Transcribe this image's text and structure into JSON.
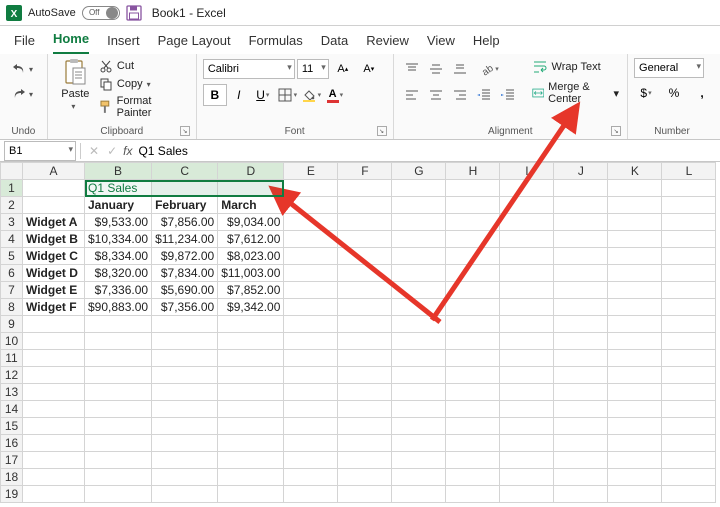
{
  "titlebar": {
    "autosave_label": "AutoSave",
    "autosave_state": "Off",
    "doc_title": "Book1 - Excel"
  },
  "tabs": {
    "file": "File",
    "home": "Home",
    "insert": "Insert",
    "page_layout": "Page Layout",
    "formulas": "Formulas",
    "data": "Data",
    "review": "Review",
    "view": "View",
    "help": "Help"
  },
  "ribbon": {
    "undo_label": "Undo",
    "clipboard": {
      "paste": "Paste",
      "cut": "Cut",
      "copy": "Copy",
      "format_painter": "Format Painter",
      "group": "Clipboard"
    },
    "font": {
      "name": "Calibri",
      "size": "11",
      "group": "Font"
    },
    "alignment": {
      "wrap_text": "Wrap Text",
      "merge_center": "Merge & Center",
      "group": "Alignment"
    },
    "number": {
      "format": "General",
      "group": "Number"
    }
  },
  "formula_bar": {
    "name_box": "B1",
    "formula": "Q1 Sales"
  },
  "grid": {
    "columns": [
      "A",
      "B",
      "C",
      "D",
      "E",
      "F",
      "G",
      "H",
      "I",
      "J",
      "K",
      "L"
    ],
    "row_count": 19,
    "q1_title": "Q1 Sales",
    "headers": {
      "b": "January",
      "c": "February",
      "d": "March"
    },
    "rows": [
      {
        "name": "Widget A",
        "b": "$9,533.00",
        "c": "$7,856.00",
        "d": "$9,034.00"
      },
      {
        "name": "Widget B",
        "b": "$10,334.00",
        "c": "$11,234.00",
        "d": "$7,612.00"
      },
      {
        "name": "Widget C",
        "b": "$8,334.00",
        "c": "$9,872.00",
        "d": "$8,023.00"
      },
      {
        "name": "Widget D",
        "b": "$8,320.00",
        "c": "$7,834.00",
        "d": "$11,003.00"
      },
      {
        "name": "Widget E",
        "b": "$7,336.00",
        "c": "$5,690.00",
        "d": "$7,852.00"
      },
      {
        "name": "Widget F",
        "b": "$90,883.00",
        "c": "$7,356.00",
        "d": "$9,342.00"
      }
    ]
  },
  "chart_data": {
    "type": "table",
    "title": "Q1 Sales",
    "columns": [
      "January",
      "February",
      "March"
    ],
    "rows": [
      "Widget A",
      "Widget B",
      "Widget C",
      "Widget D",
      "Widget E",
      "Widget F"
    ],
    "values": [
      [
        9533.0,
        7856.0,
        9034.0
      ],
      [
        10334.0,
        11234.0,
        7612.0
      ],
      [
        8334.0,
        9872.0,
        8023.0
      ],
      [
        8320.0,
        7834.0,
        11003.0
      ],
      [
        7336.0,
        5690.0,
        7852.0
      ],
      [
        90883.0,
        7356.0,
        9342.0
      ]
    ]
  },
  "colors": {
    "accent": "#107c41",
    "arrow": "#e6362a"
  }
}
